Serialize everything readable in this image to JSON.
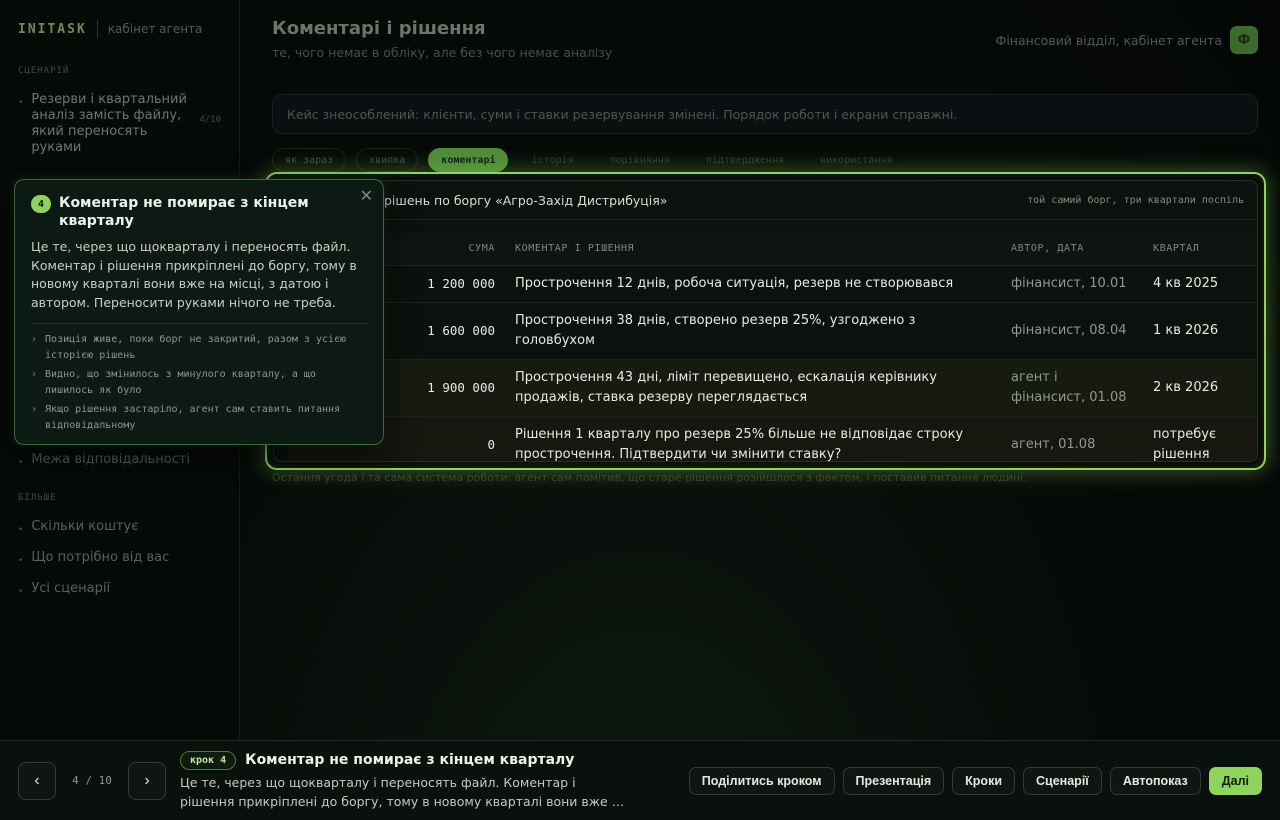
{
  "sidebar": {
    "brand": "INITASK",
    "brand_sub": "кабінет агента",
    "section_scenario": "СЦЕНАРІЙ",
    "scenario_item": "Резерви і квартальний аналіз замість файлу, який переносять руками",
    "scenario_count": "4/10",
    "item_boundary": "Межа відповідальності",
    "section_more": "БІЛЬШЕ",
    "more_items": [
      "Скільки коштує",
      "Що потрібно від вас",
      "Усі сценарії"
    ]
  },
  "header": {
    "title": "Коментарі і рішення",
    "subtitle": "те, чого немає в обліку, але без чого немає аналізу",
    "context": "Фінансовий відділ, кабінет агента",
    "avatar": "Ф"
  },
  "notice": "Кейс знеособлений: клієнти, суми і ставки резервування змінені. Порядок роботи і екрани справжні.",
  "tabs": [
    "як зараз",
    "хвилка",
    "коментарі",
    "історія",
    "порівняння",
    "підтвердження",
    "використання"
  ],
  "card": {
    "title": "рішень по боргу «Агро-Захід Дистрибуція»",
    "tag": "той самий борг, три квартали поспіль",
    "columns": {
      "sum": "СУМА",
      "comment": "КОМЕНТАР І РІШЕННЯ",
      "author": "АВТОР, ДАТА",
      "quarter": "КВАРТАЛ"
    },
    "rows": [
      {
        "sum": "1 200 000",
        "comment": "Прострочення 12 днів, робоча ситуація, резерв не створювався",
        "author": "фінансист, 10.01",
        "quarter": "4 кв 2025"
      },
      {
        "sum": "1 600 000",
        "comment": "Прострочення 38 днів, створено резерв 25%, узгоджено з головбухом",
        "author": "фінансист, 08.04",
        "quarter": "1 кв 2026"
      },
      {
        "sum": "1 900 000",
        "comment": "Прострочення 43 дні, ліміт перевищено, ескалація керівнику продажів, ставка резерву переглядається",
        "author": "агент і фінансист, 01.08",
        "quarter": "2 кв 2026"
      },
      {
        "sum": "0",
        "comment": "Рішення 1 кварталу про резерв 25% більше не відповідає строку прострочення. Підтвердити чи змінити ставку?",
        "author": "агент, 01.08",
        "quarter": "потребує рішення"
      }
    ]
  },
  "footnote": "Остання угода і та сама система роботи: агент сам помітив, що старе рішення розійшлося з фактом, і поставив питання людині.",
  "tooltip": {
    "number": "4",
    "title": "Коментар не помирає з кінцем кварталу",
    "body": "Це те, через що щокварталу і переносять файл. Коментар і рішення прикріплені до боргу, тому в новому кварталі вони вже на місці, з датою і автором. Переносити руками нічого не треба.",
    "points": [
      "Позиція живе, поки борг не закритий, разом з усією історією рішень",
      "Видно, що змінилось з минулого кварталу, а що лишилось як було",
      "Якщо рішення застаріло, агент сам ставить питання відповідальному"
    ],
    "close": "✕"
  },
  "bottom": {
    "prev": "‹",
    "next": "›",
    "pager": "4 / 10",
    "step_badge": "крок 4",
    "step_title": "Коментар не помирає з кінцем кварталу",
    "step_desc": "Це те, через що щокварталу і переносять файл. Коментар і рішення прикріплені до боргу, тому в новому кварталі вони вже …",
    "actions": {
      "share": "Поділитись кроком",
      "presentation": "Презентація",
      "steps": "Кроки",
      "scenarios": "Сценарії",
      "autoplay": "Автопоказ",
      "next": "Далі"
    }
  },
  "colors": {
    "accent": "#8ed45c",
    "background": "#050906"
  }
}
